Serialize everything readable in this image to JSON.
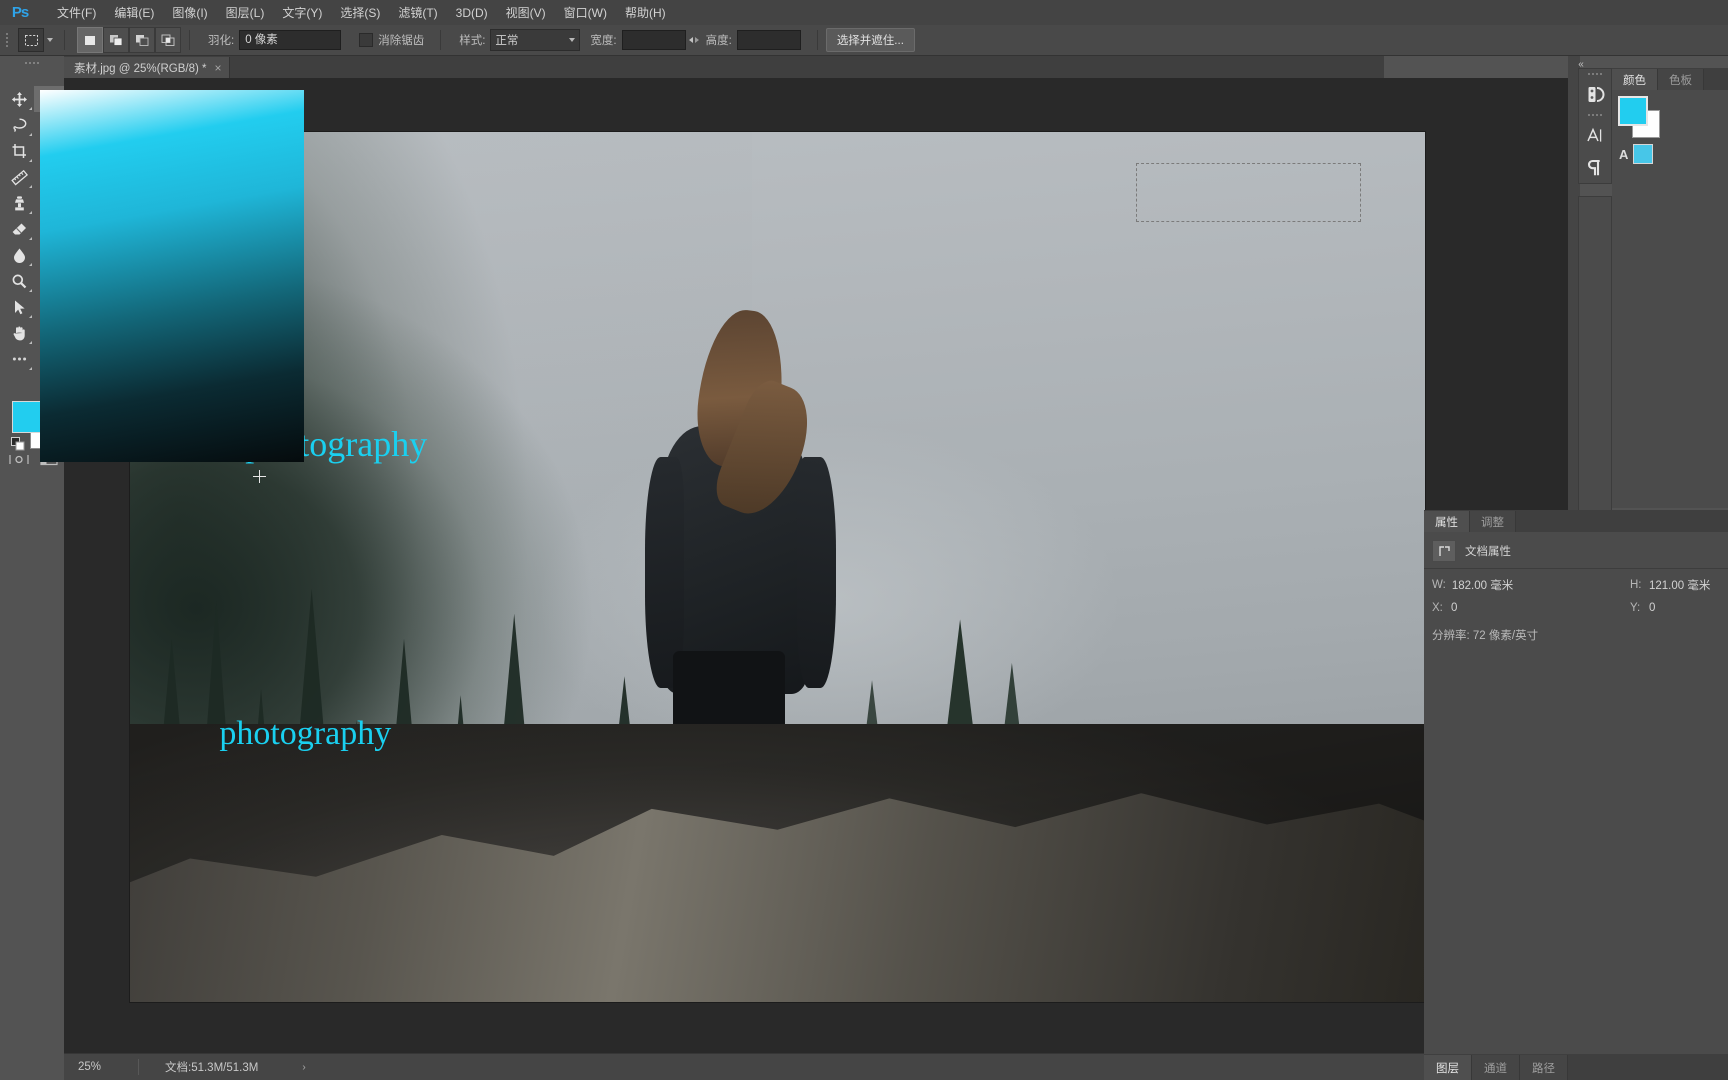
{
  "app": {
    "name": "Ps",
    "title": "Adobe Photoshop"
  },
  "menubar": {
    "items": [
      {
        "label": "文件(F)",
        "name": "menu-file"
      },
      {
        "label": "编辑(E)",
        "name": "menu-edit"
      },
      {
        "label": "图像(I)",
        "name": "menu-image"
      },
      {
        "label": "图层(L)",
        "name": "menu-layer"
      },
      {
        "label": "文字(Y)",
        "name": "menu-type"
      },
      {
        "label": "选择(S)",
        "name": "menu-select"
      },
      {
        "label": "滤镜(T)",
        "name": "menu-filter"
      },
      {
        "label": "3D(D)",
        "name": "menu-3d"
      },
      {
        "label": "视图(V)",
        "name": "menu-view"
      },
      {
        "label": "窗口(W)",
        "name": "menu-window"
      },
      {
        "label": "帮助(H)",
        "name": "menu-help"
      }
    ]
  },
  "options_bar": {
    "tool": "rectangular-marquee-tool",
    "selection_modes": [
      "new-selection",
      "add-to-selection",
      "subtract-from-selection",
      "intersect-with-selection"
    ],
    "active_selection_mode": "new-selection",
    "feather_label": "羽化:",
    "feather_value": "0 像素",
    "antialias_label": "消除锯齿",
    "antialias_checked": false,
    "style_label": "样式:",
    "style_value": "正常",
    "width_label": "宽度:",
    "width_value": "",
    "height_label": "高度:",
    "height_value": "",
    "select_and_mask_label": "选择并遮住..."
  },
  "document_tab": {
    "title": "素材.jpg @ 25%(RGB/8) *",
    "close_glyph": "×"
  },
  "toolbar": {
    "tools_left": [
      {
        "name": "move-tool",
        "glyph": "move"
      },
      {
        "name": "lasso-tool",
        "glyph": "lasso"
      },
      {
        "name": "crop-tool",
        "glyph": "crop"
      },
      {
        "name": "ruler-tool",
        "glyph": "ruler"
      },
      {
        "name": "clone-stamp-tool",
        "glyph": "stamp"
      },
      {
        "name": "eraser-tool",
        "glyph": "eraser"
      },
      {
        "name": "blur-tool",
        "glyph": "drop"
      },
      {
        "name": "dodge-tool",
        "glyph": "dodge"
      },
      {
        "name": "path-selection-tool",
        "glyph": "arrow"
      },
      {
        "name": "hand-tool",
        "glyph": "hand"
      },
      {
        "name": "edit-toolbar-tool",
        "glyph": "ellipsis"
      }
    ],
    "tools_right": [
      {
        "name": "rectangular-marquee-tool",
        "glyph": "marquee",
        "selected": true
      },
      {
        "name": "spot-healing-brush-tool",
        "glyph": "healing"
      },
      {
        "name": "eyedropper-tool",
        "glyph": "eyedropper"
      },
      {
        "name": "brush-tool",
        "glyph": "brush"
      },
      {
        "name": "history-brush-tool",
        "glyph": "historybrush"
      },
      {
        "name": "gradient-tool",
        "glyph": "paintbucket"
      },
      {
        "name": "pen-tool",
        "glyph": "pen"
      },
      {
        "name": "horizontal-type-tool",
        "glyph": "type"
      },
      {
        "name": "line-tool",
        "glyph": "line"
      },
      {
        "name": "zoom-tool",
        "glyph": "zoom"
      }
    ],
    "foreground_color": "#22cdef",
    "background_color": "#ffffff",
    "bottom_tools": [
      {
        "name": "quick-mask-toggle",
        "glyph": "quickmask"
      },
      {
        "name": "screen-mode-toggle",
        "glyph": "screenmode"
      }
    ]
  },
  "canvas": {
    "zoom": "25%",
    "texts": [
      {
        "content": "photography",
        "name": "canvas-text-1"
      },
      {
        "content": "photography",
        "name": "canvas-text-2"
      }
    ],
    "marquee_selection": {
      "visible": true,
      "name": "marquee-selection"
    },
    "text_color": "#1ad0f0"
  },
  "right_dock": {
    "collapse_glyph": "«",
    "icon_buttons": [
      {
        "name": "color-panel-icon",
        "glyph": "color"
      },
      {
        "name": "character-panel-icon",
        "glyph": "A"
      },
      {
        "name": "paragraph-panel-icon",
        "glyph": "¶"
      }
    ]
  },
  "color_panel": {
    "tabs": [
      {
        "label": "颜色",
        "name": "tab-color",
        "active": true
      },
      {
        "label": "色板",
        "name": "tab-swatches",
        "active": false
      }
    ],
    "foreground": "#22cdef",
    "background": "#ffffff",
    "mode_swatch": "#47c6e8",
    "mode_label": "A"
  },
  "properties_panel": {
    "tabs": [
      {
        "label": "属性",
        "name": "tab-properties",
        "active": true
      },
      {
        "label": "调整",
        "name": "tab-adjustments",
        "active": false
      }
    ],
    "heading": "文档属性",
    "rows": [
      {
        "label": "W:",
        "value": "182.00 毫米",
        "label2": "H:",
        "value2": "121.00 毫米"
      },
      {
        "label": "X:",
        "value": "0",
        "label2": "Y:",
        "value2": "0"
      }
    ],
    "resolution_label": "分辨率: 72 像素/英寸"
  },
  "bottom_tabs": [
    {
      "label": "图层",
      "name": "tab-layers",
      "active": true
    },
    {
      "label": "通道",
      "name": "tab-channels",
      "active": false
    },
    {
      "label": "路径",
      "name": "tab-paths",
      "active": false
    }
  ],
  "statusbar": {
    "zoom": "25%",
    "doc_info": "文档:51.3M/51.3M",
    "arrow_glyph": "›"
  }
}
